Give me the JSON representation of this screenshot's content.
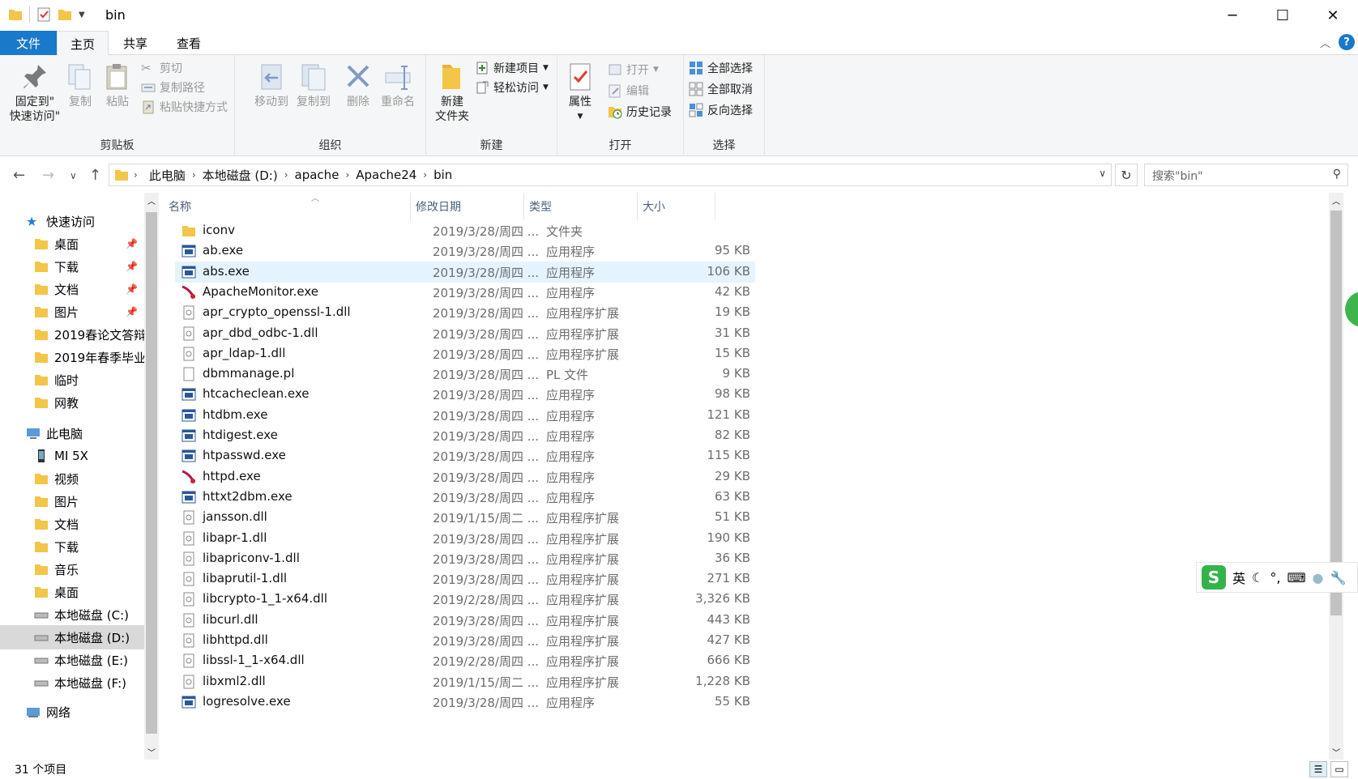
{
  "window": {
    "title": "bin",
    "minimize": "─",
    "maximize": "☐",
    "close": "✕"
  },
  "tabs": {
    "file": "文件",
    "home": "主页",
    "share": "共享",
    "view": "查看"
  },
  "ribbon": {
    "clipboard": {
      "label": "剪贴板",
      "pin": "固定到\"\n快速访问\"",
      "pin_line1": "固定到\"",
      "pin_line2": "快速访问\"",
      "copy": "复制",
      "paste": "粘贴",
      "cut": "剪切",
      "copy_path": "复制路径",
      "paste_shortcut": "粘贴快捷方式"
    },
    "organize": {
      "label": "组织",
      "move_to": "移动到",
      "copy_to": "复制到",
      "delete": "删除",
      "rename": "重命名"
    },
    "new": {
      "label": "新建",
      "new_folder_line1": "新建",
      "new_folder_line2": "文件夹",
      "new_item": "新建项目",
      "easy_access": "轻松访问"
    },
    "open": {
      "label": "打开",
      "properties": "属性",
      "open": "打开",
      "edit": "编辑",
      "history": "历史记录"
    },
    "select": {
      "label": "选择",
      "select_all": "全部选择",
      "select_none": "全部取消",
      "invert": "反向选择"
    }
  },
  "address": {
    "crumbs": [
      "此电脑",
      "本地磁盘 (D:)",
      "apache",
      "Apache24",
      "bin"
    ],
    "search_placeholder": "搜索\"bin\""
  },
  "nav": {
    "quick_access": "快速访问",
    "items": [
      {
        "label": "桌面",
        "pinned": true
      },
      {
        "label": "下载",
        "pinned": true
      },
      {
        "label": "文档",
        "pinned": true
      },
      {
        "label": "图片",
        "pinned": true
      },
      {
        "label": "2019春论文答辩",
        "pinned": false
      },
      {
        "label": "2019年春季毕业",
        "pinned": false
      },
      {
        "label": "临时",
        "pinned": false
      },
      {
        "label": "网教",
        "pinned": false
      }
    ],
    "this_pc": "此电脑",
    "pc_items": [
      "MI 5X",
      "视频",
      "图片",
      "文档",
      "下载",
      "音乐",
      "桌面",
      "本地磁盘 (C:)",
      "本地磁盘 (D:)",
      "本地磁盘 (E:)",
      "本地磁盘 (F:)"
    ],
    "network": "网络"
  },
  "columns": {
    "name": "名称",
    "date": "修改日期",
    "type": "类型",
    "size": "大小"
  },
  "files": [
    {
      "name": "iconv",
      "date": "2019/3/28/周四 ...",
      "type": "文件夹",
      "size": "",
      "icon": "folder"
    },
    {
      "name": "ab.exe",
      "date": "2019/3/28/周四 ...",
      "type": "应用程序",
      "size": "95 KB",
      "icon": "exe"
    },
    {
      "name": "abs.exe",
      "date": "2019/3/28/周四 ...",
      "type": "应用程序",
      "size": "106 KB",
      "icon": "exe"
    },
    {
      "name": "ApacheMonitor.exe",
      "date": "2019/3/28/周四 ...",
      "type": "应用程序",
      "size": "42 KB",
      "icon": "feather"
    },
    {
      "name": "apr_crypto_openssl-1.dll",
      "date": "2019/3/28/周四 ...",
      "type": "应用程序扩展",
      "size": "19 KB",
      "icon": "dll"
    },
    {
      "name": "apr_dbd_odbc-1.dll",
      "date": "2019/3/28/周四 ...",
      "type": "应用程序扩展",
      "size": "31 KB",
      "icon": "dll"
    },
    {
      "name": "apr_ldap-1.dll",
      "date": "2019/3/28/周四 ...",
      "type": "应用程序扩展",
      "size": "15 KB",
      "icon": "dll"
    },
    {
      "name": "dbmmanage.pl",
      "date": "2019/3/28/周四 ...",
      "type": "PL 文件",
      "size": "9 KB",
      "icon": "doc"
    },
    {
      "name": "htcacheclean.exe",
      "date": "2019/3/28/周四 ...",
      "type": "应用程序",
      "size": "98 KB",
      "icon": "exe"
    },
    {
      "name": "htdbm.exe",
      "date": "2019/3/28/周四 ...",
      "type": "应用程序",
      "size": "121 KB",
      "icon": "exe"
    },
    {
      "name": "htdigest.exe",
      "date": "2019/3/28/周四 ...",
      "type": "应用程序",
      "size": "82 KB",
      "icon": "exe"
    },
    {
      "name": "htpasswd.exe",
      "date": "2019/3/28/周四 ...",
      "type": "应用程序",
      "size": "115 KB",
      "icon": "exe"
    },
    {
      "name": "httpd.exe",
      "date": "2019/3/28/周四 ...",
      "type": "应用程序",
      "size": "29 KB",
      "icon": "feather"
    },
    {
      "name": "httxt2dbm.exe",
      "date": "2019/3/28/周四 ...",
      "type": "应用程序",
      "size": "63 KB",
      "icon": "exe"
    },
    {
      "name": "jansson.dll",
      "date": "2019/1/15/周二 ...",
      "type": "应用程序扩展",
      "size": "51 KB",
      "icon": "dll"
    },
    {
      "name": "libapr-1.dll",
      "date": "2019/3/28/周四 ...",
      "type": "应用程序扩展",
      "size": "190 KB",
      "icon": "dll"
    },
    {
      "name": "libapriconv-1.dll",
      "date": "2019/3/28/周四 ...",
      "type": "应用程序扩展",
      "size": "36 KB",
      "icon": "dll"
    },
    {
      "name": "libaprutil-1.dll",
      "date": "2019/3/28/周四 ...",
      "type": "应用程序扩展",
      "size": "271 KB",
      "icon": "dll"
    },
    {
      "name": "libcrypto-1_1-x64.dll",
      "date": "2019/2/28/周四 ...",
      "type": "应用程序扩展",
      "size": "3,326 KB",
      "icon": "dll"
    },
    {
      "name": "libcurl.dll",
      "date": "2019/3/28/周四 ...",
      "type": "应用程序扩展",
      "size": "443 KB",
      "icon": "dll"
    },
    {
      "name": "libhttpd.dll",
      "date": "2019/3/28/周四 ...",
      "type": "应用程序扩展",
      "size": "427 KB",
      "icon": "dll"
    },
    {
      "name": "libssl-1_1-x64.dll",
      "date": "2019/2/28/周四 ...",
      "type": "应用程序扩展",
      "size": "666 KB",
      "icon": "dll"
    },
    {
      "name": "libxml2.dll",
      "date": "2019/1/15/周二 ...",
      "type": "应用程序扩展",
      "size": "1,228 KB",
      "icon": "dll"
    },
    {
      "name": "logresolve.exe",
      "date": "2019/3/28/周四 ...",
      "type": "应用程序",
      "size": "55 KB",
      "icon": "exe"
    }
  ],
  "selected_file": "abs.exe",
  "status": {
    "count": "31 个项目"
  },
  "ime": {
    "mode": "英"
  },
  "colors": {
    "accent": "#1979ca",
    "selection": "#e5f3ff",
    "folder": "#f3c548"
  }
}
